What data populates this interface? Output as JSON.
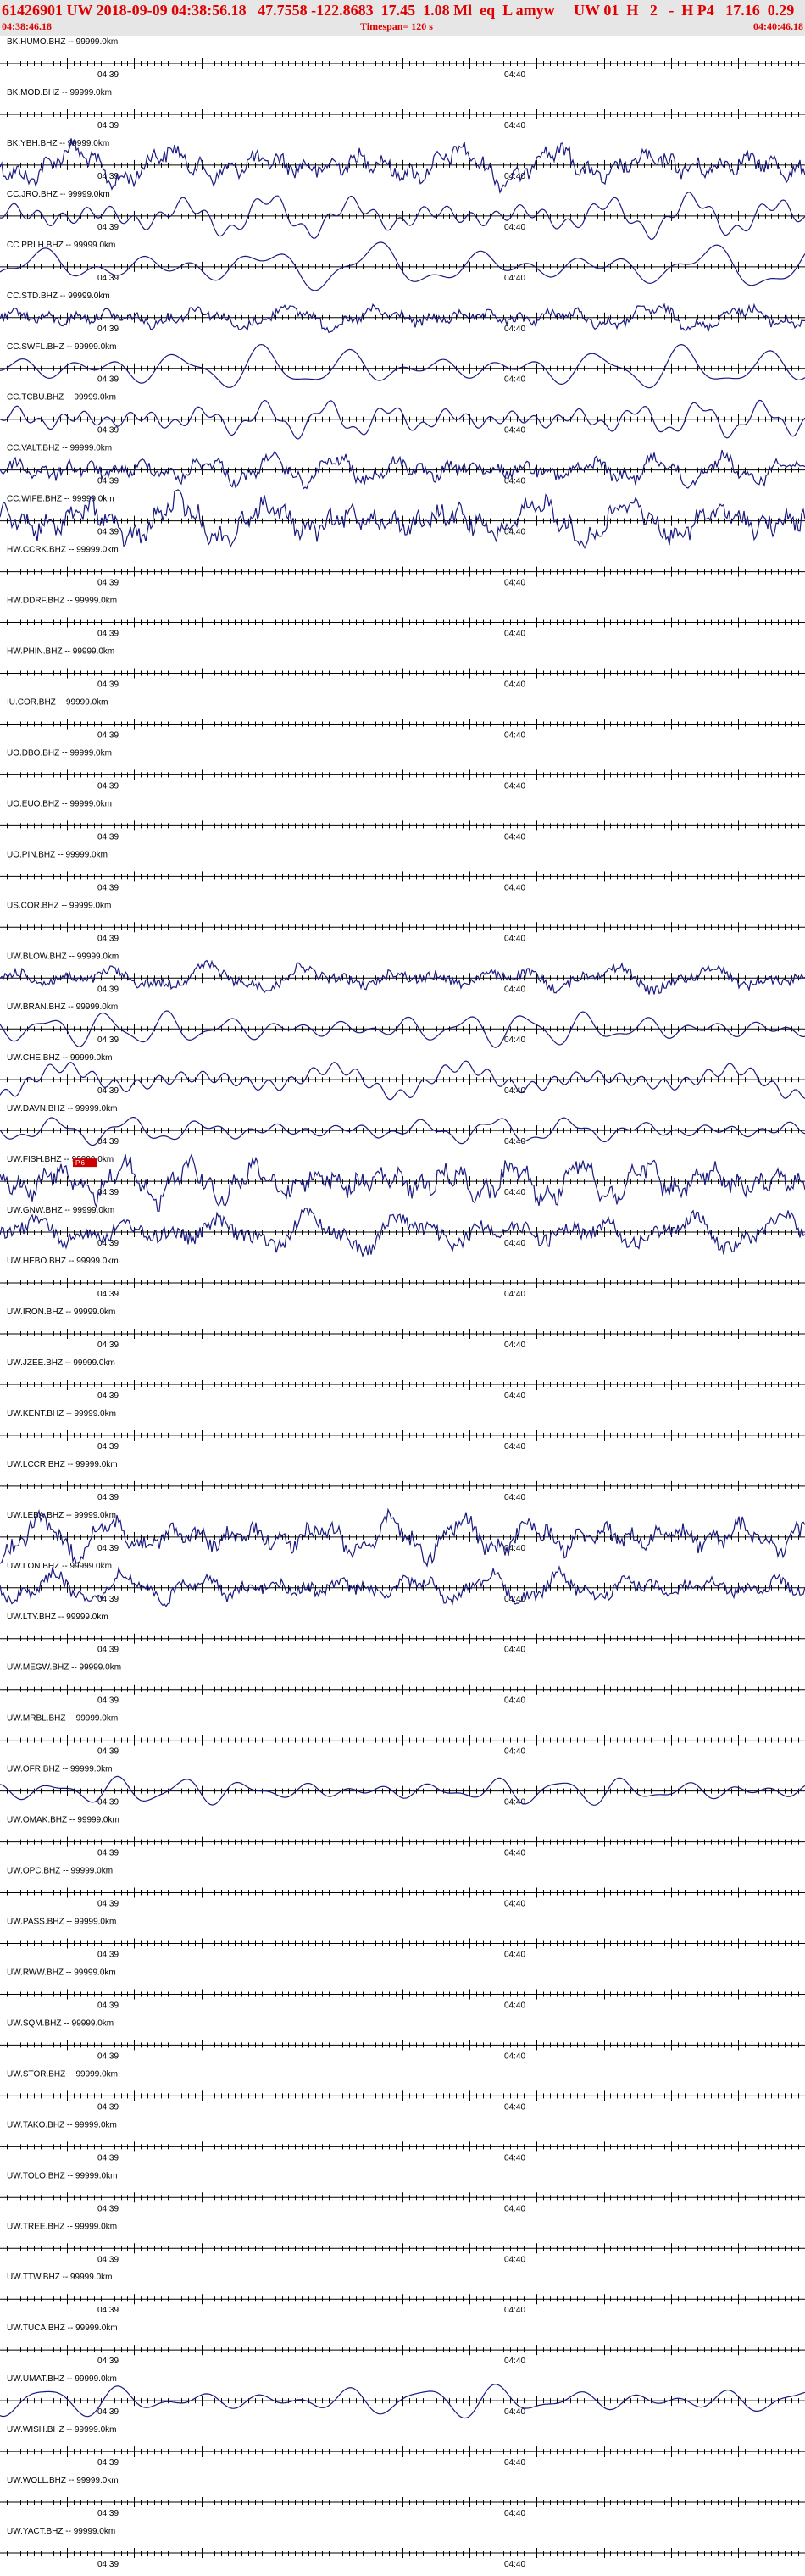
{
  "header": {
    "line1": "61426901 UW 2018-09-09 04:38:56.18   47.7558 -122.8683  17.45  1.08 Ml  eq  L amyw     UW 01  H   2   -  H P4   17.16  0.29",
    "start_time": "04:38:46.18",
    "timespan": "Timespan= 120 s",
    "end_time": "04:40:46.18"
  },
  "colors": {
    "header_text": "#e00000",
    "trace": "#1a1a80",
    "pick": "#cc0000",
    "axis": "#000000"
  },
  "chart_data": {
    "type": "line",
    "title": "61426901 UW 2018-09-09 04:38:56.18",
    "x_tick_labels": [
      "04:39",
      "04:40"
    ],
    "traces": [
      {
        "label": "BK.HUMO.BHZ -- 99999.0km",
        "active": false
      },
      {
        "label": "BK.MOD.BHZ -- 99999.0km",
        "active": false
      },
      {
        "label": "BK.YBH.BHZ -- 99999.0km",
        "active": true
      },
      {
        "label": "CC.JRO.BHZ -- 99999.0km",
        "active": true
      },
      {
        "label": "CC.PRLH.BHZ -- 99999.0km",
        "active": true
      },
      {
        "label": "CC.STD.BHZ -- 99999.0km",
        "active": true
      },
      {
        "label": "CC.SWFL.BHZ -- 99999.0km",
        "active": true
      },
      {
        "label": "CC.TCBU.BHZ -- 99999.0km",
        "active": true
      },
      {
        "label": "CC.VALT.BHZ -- 99999.0km",
        "active": true
      },
      {
        "label": "CC.WIFE.BHZ -- 99999.0km",
        "active": true
      },
      {
        "label": "HW.CCRK.BHZ -- 99999.0km",
        "active": false
      },
      {
        "label": "HW.DDRF.BHZ -- 99999.0km",
        "active": false
      },
      {
        "label": "HW.PHIN.BHZ -- 99999.0km",
        "active": false
      },
      {
        "label": "IU.COR.BHZ -- 99999.0km",
        "active": false
      },
      {
        "label": "UO.DBO.BHZ -- 99999.0km",
        "active": false
      },
      {
        "label": "UO.EUO.BHZ -- 99999.0km",
        "active": false
      },
      {
        "label": "UO.PIN.BHZ -- 99999.0km",
        "active": false
      },
      {
        "label": "US.COR.BHZ -- 99999.0km",
        "active": false
      },
      {
        "label": "UW.BLOW.BHZ -- 99999.0km",
        "active": true
      },
      {
        "label": "UW.BRAN.BHZ -- 99999.0km",
        "active": true
      },
      {
        "label": "UW.CHE.BHZ -- 99999.0km",
        "active": true
      },
      {
        "label": "UW.DAVN.BHZ -- 99999.0km",
        "active": true
      },
      {
        "label": "UW.FISH.BHZ -- 99999.0km",
        "active": true,
        "pick": "P.6"
      },
      {
        "label": "UW.GNW.BHZ -- 99999.0km",
        "active": true
      },
      {
        "label": "UW.HEBO.BHZ -- 99999.0km",
        "active": false
      },
      {
        "label": "UW.IRON.BHZ -- 99999.0km",
        "active": false
      },
      {
        "label": "UW.JZEE.BHZ -- 99999.0km",
        "active": false
      },
      {
        "label": "UW.KENT.BHZ -- 99999.0km",
        "active": false
      },
      {
        "label": "UW.LCCR.BHZ -- 99999.0km",
        "active": false
      },
      {
        "label": "UW.LEBA.BHZ -- 99999.0km",
        "active": true
      },
      {
        "label": "UW.LON.BHZ -- 99999.0km",
        "active": true
      },
      {
        "label": "UW.LTY.BHZ -- 99999.0km",
        "active": false
      },
      {
        "label": "UW.MEGW.BHZ -- 99999.0km",
        "active": false
      },
      {
        "label": "UW.MRBL.BHZ -- 99999.0km",
        "active": false
      },
      {
        "label": "UW.OFR.BHZ -- 99999.0km",
        "active": true
      },
      {
        "label": "UW.OMAK.BHZ -- 99999.0km",
        "active": false
      },
      {
        "label": "UW.OPC.BHZ -- 99999.0km",
        "active": false
      },
      {
        "label": "UW.PASS.BHZ -- 99999.0km",
        "active": false
      },
      {
        "label": "UW.RWW.BHZ -- 99999.0km",
        "active": false
      },
      {
        "label": "UW.SQM.BHZ -- 99999.0km",
        "active": false
      },
      {
        "label": "UW.STOR.BHZ -- 99999.0km",
        "active": false
      },
      {
        "label": "UW.TAKO.BHZ -- 99999.0km",
        "active": false
      },
      {
        "label": "UW.TOLO.BHZ -- 99999.0km",
        "active": false
      },
      {
        "label": "UW.TREE.BHZ -- 99999.0km",
        "active": false
      },
      {
        "label": "UW.TTW.BHZ -- 99999.0km",
        "active": false
      },
      {
        "label": "UW.TUCA.BHZ -- 99999.0km",
        "active": false
      },
      {
        "label": "UW.UMAT.BHZ -- 99999.0km",
        "active": true
      },
      {
        "label": "UW.WISH.BHZ -- 99999.0km",
        "active": false
      },
      {
        "label": "UW.WOLL.BHZ -- 99999.0km",
        "active": false
      },
      {
        "label": "UW.YACT.BHZ -- 99999.0km",
        "active": false
      }
    ]
  }
}
